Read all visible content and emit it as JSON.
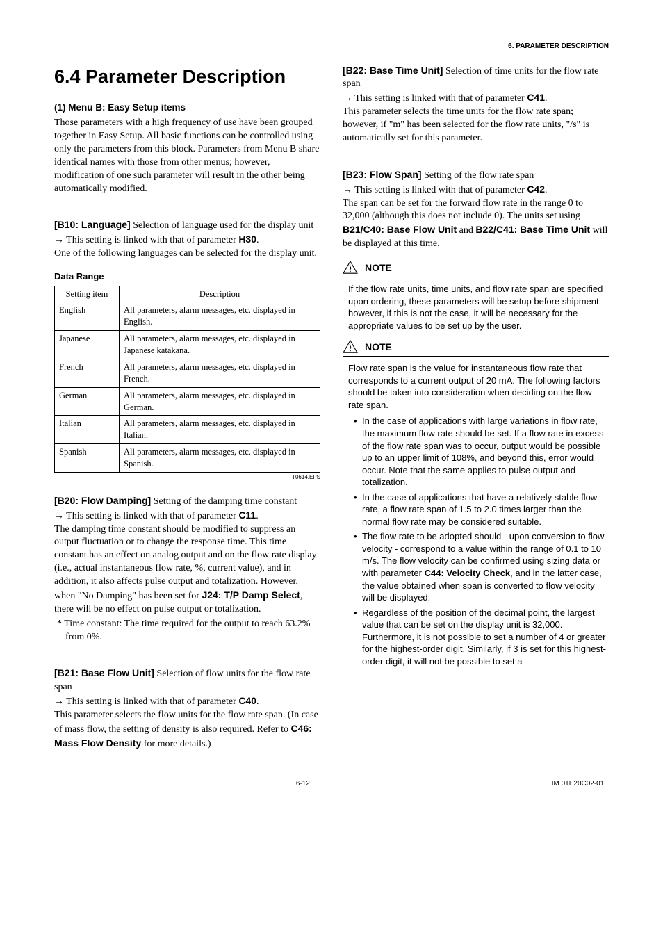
{
  "header": {
    "breadcrumb": "6.  PARAMETER DESCRIPTION"
  },
  "title": "6.4   Parameter Description",
  "left": {
    "menuB": {
      "heading": "(1) Menu B: Easy Setup items",
      "body": "Those parameters with a high frequency of use have been grouped together in Easy Setup. All basic functions can be controlled using only the parameters from this block. Parameters from Menu B share identical names with those from other menus; however, modification of one such parameter will result in the other being automatically modified."
    },
    "b10": {
      "label": "[B10: Language]",
      "after": " Selection of language used for the display unit",
      "link_pre": "→ This setting is linked with that of parameter ",
      "link_code": "H30",
      "body": "One of the following languages can be selected for the display unit."
    },
    "dataRangeLabel": "Data Range",
    "table": {
      "h1": "Setting item",
      "h2": "Description",
      "rows": [
        {
          "k": "English",
          "v": "All parameters, alarm messages, etc. displayed in English."
        },
        {
          "k": "Japanese",
          "v": "All parameters, alarm messages, etc. displayed in Japanese katakana."
        },
        {
          "k": "French",
          "v": "All parameters, alarm messages, etc. displayed in French."
        },
        {
          "k": "German",
          "v": "All parameters, alarm messages, etc. displayed in German."
        },
        {
          "k": "Italian",
          "v": "All parameters, alarm messages, etc. displayed in Italian."
        },
        {
          "k": "Spanish",
          "v": "All parameters, alarm messages, etc. displayed in Spanish."
        }
      ],
      "footnote": "T0614.EPS"
    },
    "b20": {
      "label": "[B20: Flow Damping]",
      "after": " Setting of the damping time constant",
      "link_pre": "→ This setting is linked with that of parameter ",
      "link_code": "C11",
      "body_a": "The damping time constant should be modified to suppress an output fluctuation or to change the response time. This time constant has an effect on analog output and on the flow rate display (i.e., actual instantaneous flow rate, %, current value), and in addition, it also affects pulse output and totalization. However, when \"No Damping\" has been set for ",
      "body_code": "J24: T/P Damp Select",
      "body_b": ", there will be no effect on pulse output or totalization.",
      "star": "* Time constant: The time required for the output to reach 63.2% from 0%."
    },
    "b21": {
      "label": "[B21: Base Flow Unit]",
      "after": " Selection of flow units for the flow rate span",
      "link_pre": "→ This setting is linked with that of parameter ",
      "link_code": "C40",
      "body_a": "This parameter selects the flow units for the flow rate span. (In case of mass flow, the setting of density is also required.  Refer to ",
      "body_code": "C46: Mass Flow Density",
      "body_b": " for more details.)"
    }
  },
  "right": {
    "b22": {
      "label": "[B22: Base Time Unit]",
      "after": " Selection of time units for the flow rate span",
      "link_pre": "→ This setting is linked with that of parameter ",
      "link_code": "C41",
      "body": "This parameter selects the time units for the flow rate span; however, if \"m\" has been selected for the flow rate units, \"/s\" is automatically set for this parameter."
    },
    "b23": {
      "label": "[B23: Flow Span]",
      "after": " Setting of the flow rate span",
      "link_pre": "→ This setting is linked with that of parameter ",
      "link_code": "C42",
      "body_a": "The span can be set for the forward flow rate in the range 0 to 32,000 (although this does not include 0). The units set using ",
      "code1": "B21/C40: Base Flow Unit",
      "mid": " and ",
      "code2": "B22/C41: Base Time Unit",
      "body_b": " will be displayed at this time."
    },
    "note1": {
      "label": "NOTE",
      "body": "If the flow rate units, time units, and flow rate span are specified upon ordering, these parameters will be setup before shipment; however, if this is not the case, it will be necessary for the appropriate values to be set up by the user."
    },
    "note2": {
      "label": "NOTE",
      "lead": "Flow rate span is the value for instantaneous flow rate that corresponds to a current output of 20 mA. The following factors should be taken into consideration when deciding on the flow rate span.",
      "bullets": [
        "In the case of applications with large variations in flow rate, the maximum flow rate should be set. If a flow rate in excess of the flow rate span was to occur, output would be possible up to an upper limit of 108%, and beyond this, error would occur. Note that the same applies to pulse output and totalization.",
        "In the case of applications that have a relatively stable flow rate, a flow rate span of 1.5 to 2.0 times larger than the normal flow rate may be considered suitable.",
        "The flow rate to be adopted should - upon conversion to flow velocity - correspond to a value within the range of 0.1 to 10 m/s. The flow velocity can be confirmed using sizing data or with parameter C44: Velocity Check, and in the latter case, the value obtained when span is converted to flow velocity will be displayed.",
        "Regardless of the position of the decimal point, the largest value that can be set on the display unit is 32,000. Furthermore, it is not possible to set a number of 4 or greater for the highest-order digit. Similarly, if 3 is set for this highest-order digit, it will not be possible to set a"
      ],
      "bullet3_pre": "The flow rate to be adopted should - upon conversion to flow velocity - correspond to a value within the range of 0.1 to 10 m/s. The flow velocity can be confirmed using sizing data or with parameter ",
      "bullet3_code": "C44: Velocity Check",
      "bullet3_post": ", and in the latter case, the value obtained when span is converted to flow velocity will be displayed."
    }
  },
  "footer": {
    "page": "6-12",
    "doc": "IM 01E20C02-01E"
  }
}
